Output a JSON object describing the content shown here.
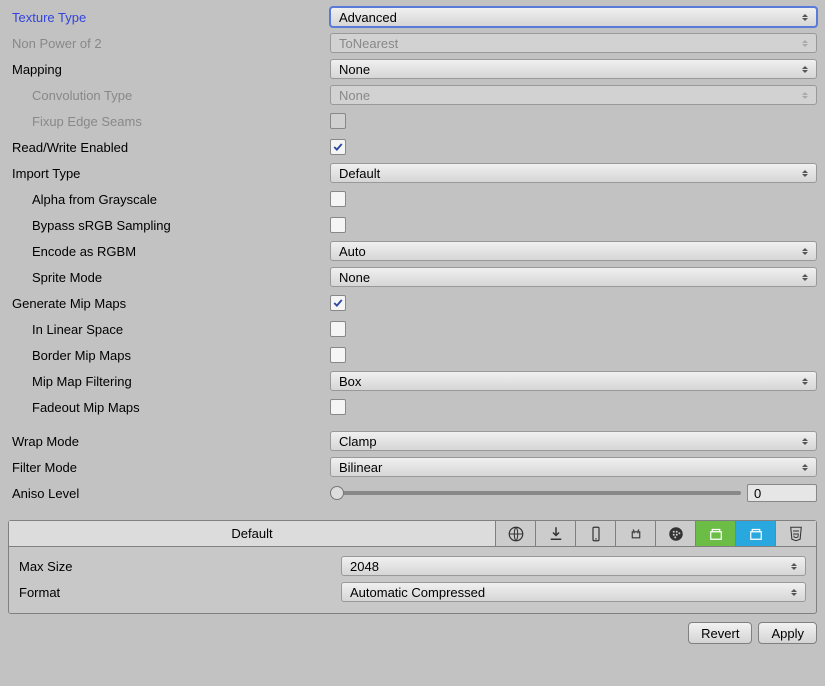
{
  "texture_type": {
    "label": "Texture Type",
    "value": "Advanced"
  },
  "npot": {
    "label": "Non Power of 2",
    "value": "ToNearest"
  },
  "mapping": {
    "label": "Mapping",
    "value": "None"
  },
  "convolution": {
    "label": "Convolution Type",
    "value": "None"
  },
  "fixup_edge": {
    "label": "Fixup Edge Seams",
    "checked": false
  },
  "read_write": {
    "label": "Read/Write Enabled",
    "checked": true
  },
  "import_type": {
    "label": "Import Type",
    "value": "Default"
  },
  "alpha_gs": {
    "label": "Alpha from Grayscale",
    "checked": false
  },
  "bypass_srgb": {
    "label": "Bypass sRGB Sampling",
    "checked": false
  },
  "encode_rgbm": {
    "label": "Encode as RGBM",
    "value": "Auto"
  },
  "sprite_mode": {
    "label": "Sprite Mode",
    "value": "None"
  },
  "gen_mip": {
    "label": "Generate Mip Maps",
    "checked": true
  },
  "linear": {
    "label": "In Linear Space",
    "checked": false
  },
  "border_mip": {
    "label": "Border Mip Maps",
    "checked": false
  },
  "mip_filter": {
    "label": "Mip Map Filtering",
    "value": "Box"
  },
  "fadeout": {
    "label": "Fadeout Mip Maps",
    "checked": false
  },
  "wrap_mode": {
    "label": "Wrap Mode",
    "value": "Clamp"
  },
  "filter_mode": {
    "label": "Filter Mode",
    "value": "Bilinear"
  },
  "aniso": {
    "label": "Aniso Level",
    "value": "0"
  },
  "platform_default_tab": "Default",
  "max_size": {
    "label": "Max Size",
    "value": "2048"
  },
  "format": {
    "label": "Format",
    "value": "Automatic Compressed"
  },
  "buttons": {
    "revert": "Revert",
    "apply": "Apply"
  }
}
